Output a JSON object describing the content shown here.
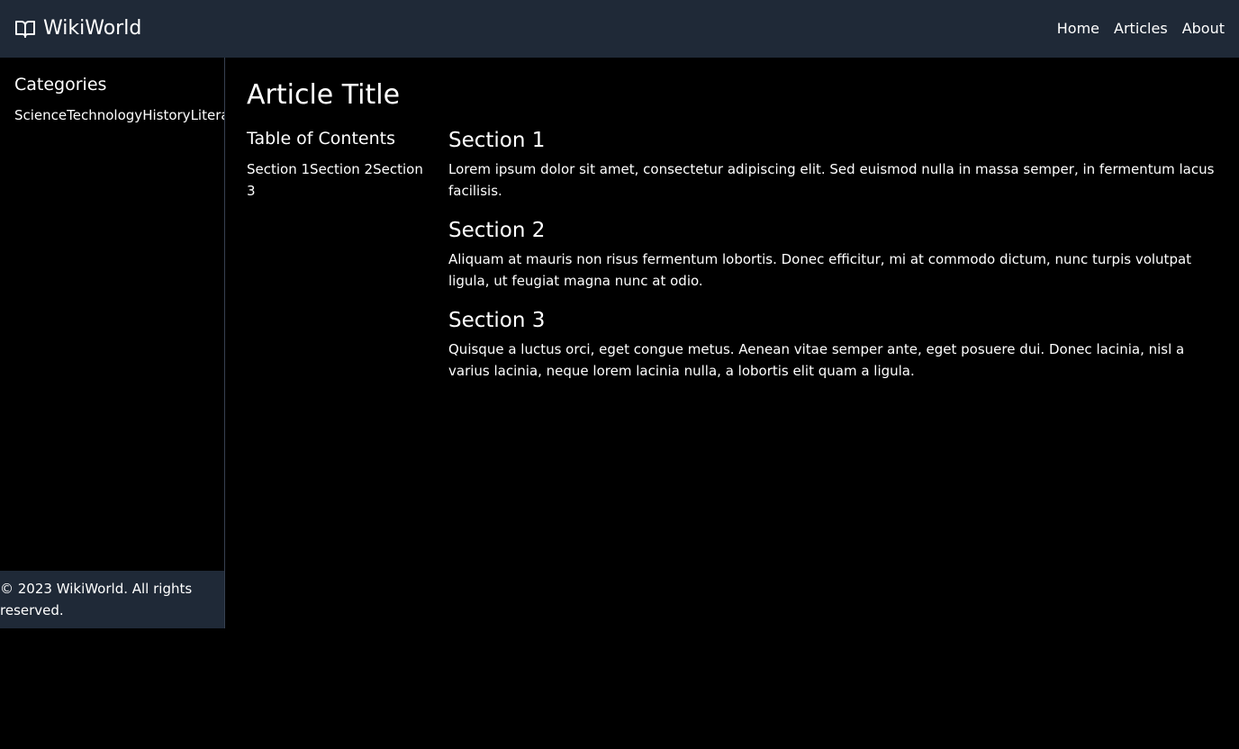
{
  "header": {
    "brand": "WikiWorld",
    "brand_icon": "book-open-icon",
    "nav": [
      "Home",
      "Articles",
      "About"
    ]
  },
  "sidebar": {
    "title": "Categories",
    "categories": [
      "Science",
      "Technology",
      "History",
      "Literature"
    ]
  },
  "footer": {
    "text": "© 2023 WikiWorld. All rights reserved."
  },
  "article": {
    "title": "Article Title",
    "toc": {
      "title": "Table of Contents",
      "items": [
        "Section 1",
        "Section 2",
        "Section 3"
      ]
    },
    "sections": [
      {
        "heading": "Section 1",
        "body": "Lorem ipsum dolor sit amet, consectetur adipiscing elit. Sed euismod nulla in massa semper, in fermentum lacus facilisis."
      },
      {
        "heading": "Section 2",
        "body": "Aliquam at mauris non risus fermentum lobortis. Donec efficitur, mi at commodo dictum, nunc turpis volutpat ligula, ut feugiat magna nunc at odio."
      },
      {
        "heading": "Section 3",
        "body": "Quisque a luctus orci, eget congue metus. Aenean vitae semper ante, eget posuere dui. Donec lacinia, nisl a varius lacinia, neque lorem lacinia nulla, a lobortis elit quam a ligula."
      }
    ]
  },
  "colors": {
    "topbar_bg": "#1f2937",
    "page_bg": "#000000",
    "text": "#ffffff",
    "divider": "#374151"
  }
}
